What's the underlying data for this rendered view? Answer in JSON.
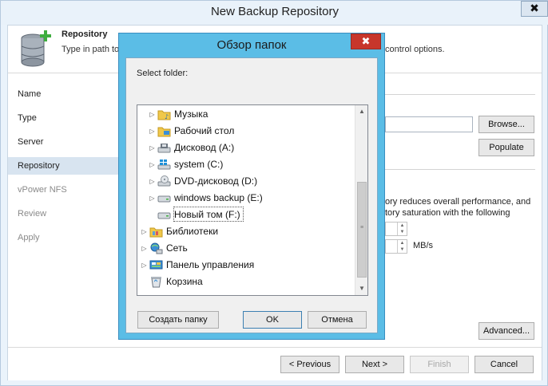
{
  "wizard": {
    "title": "New Backup Repository",
    "close_glyph": "✖",
    "header": {
      "title": "Repository",
      "description": "Type in path to",
      "description_tail": "control options."
    },
    "nav": [
      {
        "label": "Name",
        "state": "normal"
      },
      {
        "label": "Type",
        "state": "normal"
      },
      {
        "label": "Server",
        "state": "normal"
      },
      {
        "label": "Repository",
        "state": "active"
      },
      {
        "label": "vPower NFS",
        "state": "disabled"
      },
      {
        "label": "Review",
        "state": "disabled"
      },
      {
        "label": "Apply",
        "state": "disabled"
      }
    ],
    "browse_label": "Browse...",
    "populate_label": "Populate",
    "info_line1": "ory reduces overall performance, and",
    "info_line2": "tory saturation with the following",
    "spinner_unit": "MB/s",
    "advanced_label": "Advanced...",
    "footer": {
      "previous": "< Previous",
      "next": "Next >",
      "finish": "Finish",
      "cancel": "Cancel"
    }
  },
  "dialog": {
    "title": "Обзор папок",
    "close_glyph": "✖",
    "select_label": "Select folder:",
    "tree": [
      {
        "label": "Музыка",
        "icon": "music-folder-icon",
        "level": 1,
        "expandable": true
      },
      {
        "label": "Рабочий стол",
        "icon": "desktop-folder-icon",
        "level": 1,
        "expandable": true
      },
      {
        "label": "Дисковод (A:)",
        "icon": "floppy-drive-icon",
        "level": 1,
        "expandable": true
      },
      {
        "label": "system (C:)",
        "icon": "system-drive-icon",
        "level": 1,
        "expandable": true
      },
      {
        "label": "DVD-дисковод (D:)",
        "icon": "dvd-drive-icon",
        "level": 1,
        "expandable": true
      },
      {
        "label": "windows backup (E:)",
        "icon": "hard-drive-icon",
        "level": 1,
        "expandable": true
      },
      {
        "label": "Новый том (F:)",
        "icon": "hard-drive-icon",
        "level": 1,
        "expandable": false,
        "selected": true
      },
      {
        "label": "Библиотеки",
        "icon": "libraries-icon",
        "level": 0,
        "expandable": true
      },
      {
        "label": "Сеть",
        "icon": "network-icon",
        "level": 0,
        "expandable": true
      },
      {
        "label": "Панель управления",
        "icon": "control-panel-icon",
        "level": 0,
        "expandable": true
      },
      {
        "label": "Корзина",
        "icon": "recycle-bin-icon",
        "level": 0,
        "expandable": false
      }
    ],
    "new_folder_label": "Создать папку",
    "ok_label": "OK",
    "cancel_label": "Отмена"
  }
}
